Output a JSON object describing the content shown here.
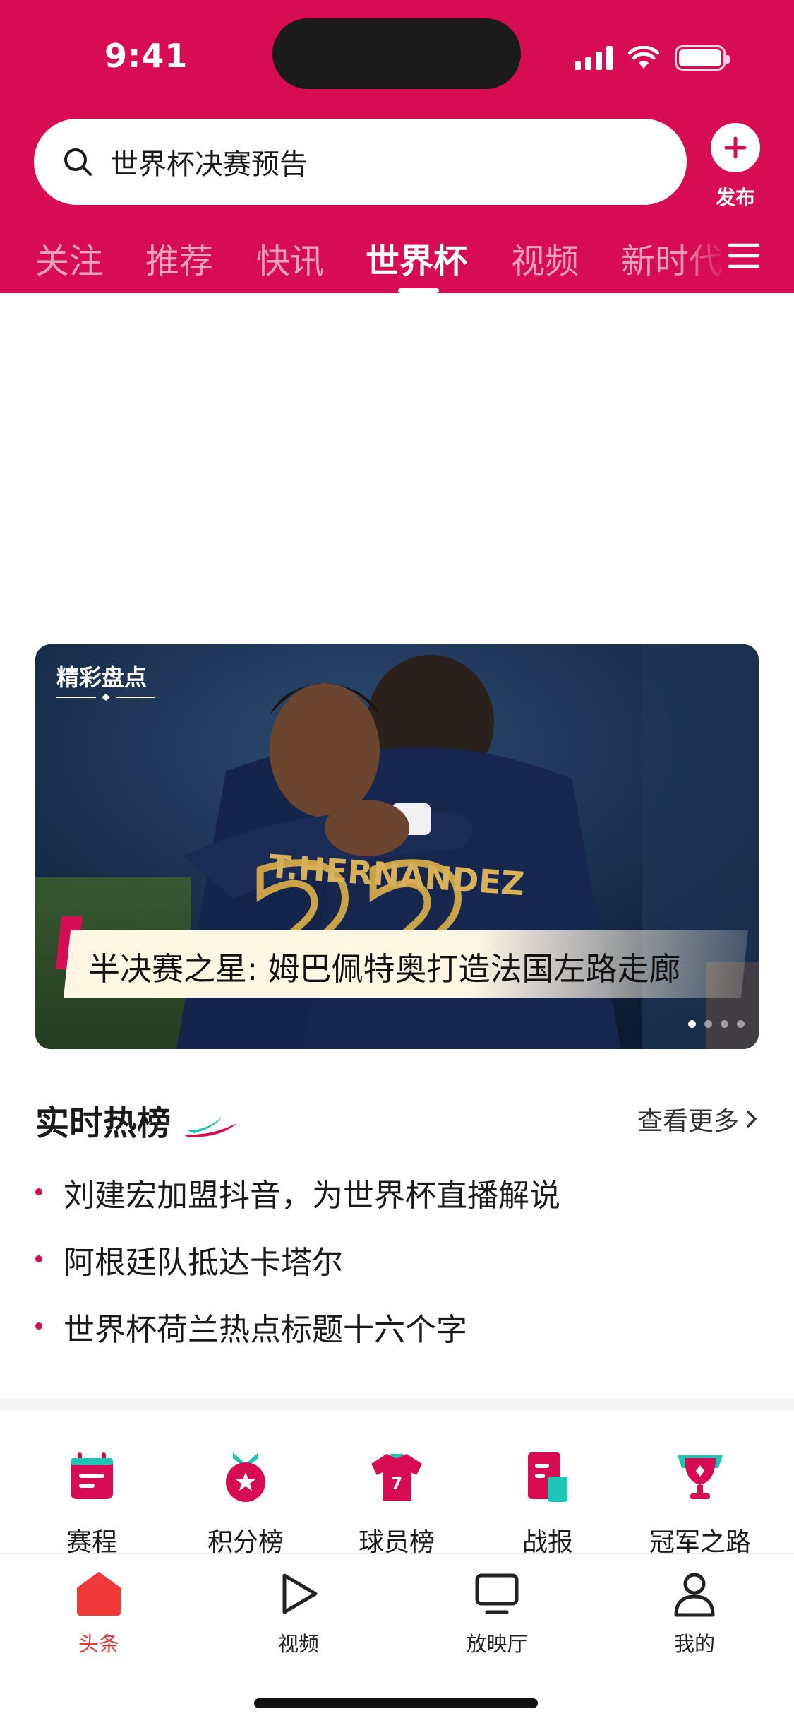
{
  "status_bar": {
    "time": "9:41"
  },
  "search": {
    "query": "世界杯决赛预告"
  },
  "publish": {
    "label": "发布"
  },
  "tabs": [
    {
      "label": "关注"
    },
    {
      "label": "推荐"
    },
    {
      "label": "快讯"
    },
    {
      "label": "世界杯",
      "active": true
    },
    {
      "label": "视频"
    },
    {
      "label": "新时代"
    }
  ],
  "banner": {
    "tag": "精彩盘点",
    "title": "半决赛之星: 姆巴佩特奥打造法国左路走廊",
    "jersey_text": "T.HERNANDEZ",
    "slide_count": 4,
    "active_slide": 1
  },
  "hot": {
    "title": "实时热榜",
    "more": "查看更多",
    "items": [
      "刘建宏加盟抖音，为世界杯直播解说",
      "阿根廷队抵达卡塔尔",
      "世界杯荷兰热点标题十六个字"
    ]
  },
  "quick_tools": [
    {
      "label": "赛程",
      "icon": "calendar-icon"
    },
    {
      "label": "积分榜",
      "icon": "medal-icon"
    },
    {
      "label": "球员榜",
      "icon": "jersey-icon"
    },
    {
      "label": "战报",
      "icon": "report-icon"
    },
    {
      "label": "冠军之路",
      "icon": "trophy-icon"
    }
  ],
  "bottom_nav": [
    {
      "label": "头条",
      "icon": "home-icon",
      "active": true
    },
    {
      "label": "视频",
      "icon": "play-icon"
    },
    {
      "label": "放映厅",
      "icon": "tv-icon"
    },
    {
      "label": "我的",
      "icon": "profile-icon"
    }
  ],
  "colors": {
    "brand": "#d80c52",
    "active_nav": "#e53935",
    "accent_teal": "#1fc4b5"
  }
}
